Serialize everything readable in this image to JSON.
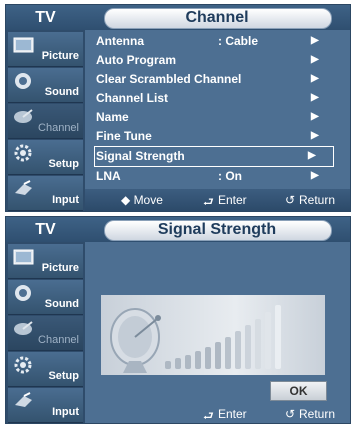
{
  "panel1": {
    "tv_label": "TV",
    "title": "Channel",
    "sidebar": [
      {
        "label": "Picture",
        "icon": "picture-icon",
        "active": true
      },
      {
        "label": "Sound",
        "icon": "sound-icon",
        "active": true
      },
      {
        "label": "Channel",
        "icon": "channel-icon",
        "active": false
      },
      {
        "label": "Setup",
        "icon": "setup-icon",
        "active": true
      },
      {
        "label": "Input",
        "icon": "input-icon",
        "active": true
      }
    ],
    "menu": [
      {
        "label": "Antenna",
        "value": ": Cable",
        "arrow": "▶"
      },
      {
        "label": "Auto Program",
        "value": "",
        "arrow": "▶"
      },
      {
        "label": "Clear Scrambled Channel",
        "value": "",
        "arrow": "▶"
      },
      {
        "label": "Channel List",
        "value": "",
        "arrow": "▶"
      },
      {
        "label": "Name",
        "value": "",
        "arrow": "▶"
      },
      {
        "label": "Fine Tune",
        "value": "",
        "arrow": "▶"
      },
      {
        "label": "Signal Strength",
        "value": "",
        "arrow": "▶"
      },
      {
        "label": "LNA",
        "value": ": On",
        "arrow": "▶"
      }
    ],
    "footer": {
      "move": "◆ Move",
      "enter": "Enter",
      "return": "Return"
    }
  },
  "panel2": {
    "tv_label": "TV",
    "title": "Signal Strength",
    "sidebar": [
      {
        "label": "Picture",
        "icon": "picture-icon"
      },
      {
        "label": "Sound",
        "icon": "sound-icon"
      },
      {
        "label": "Channel",
        "icon": "channel-icon"
      },
      {
        "label": "Setup",
        "icon": "setup-icon"
      },
      {
        "label": "Input",
        "icon": "input-icon"
      }
    ],
    "ok_label": "OK",
    "footer": {
      "enter": "Enter",
      "return": "Return"
    }
  },
  "colors": {
    "panel_bg": "#4d6f92",
    "sidebar_bg": "#2f4c6b",
    "title_text": "#1f3c5c"
  }
}
